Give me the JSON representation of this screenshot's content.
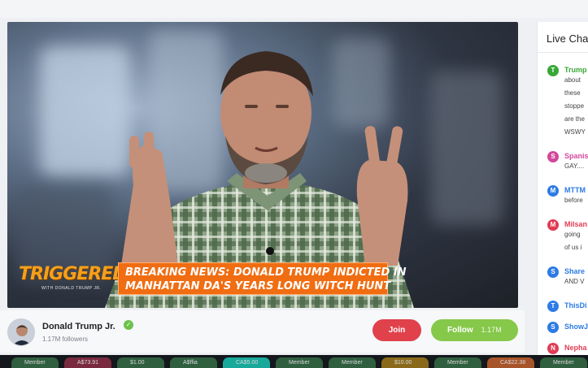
{
  "video": {
    "show_logo": "TRIGGERED",
    "show_logo_sub": "WITH DONALD TRUMP JR.",
    "banner_text": "BREAKING NEWS: DONALD TRUMP INDICTED IN\nMANHATTAN DA'S YEARS LONG WITCH HUNT"
  },
  "channel": {
    "name": "Donald Trump Jr.",
    "followers": "1.17M followers",
    "join_label": "Join",
    "follow_label": "Follow",
    "follow_count": "1.17M"
  },
  "chat": {
    "title": "Live Chat",
    "messages": [
      {
        "user": "Trump",
        "color": "#37a836",
        "lines": [
          "about",
          "these",
          "stoppe",
          "are the",
          "WSWY"
        ]
      },
      {
        "user": "Spanis",
        "color": "#d2489a",
        "lines": [
          "GAY...."
        ]
      },
      {
        "user": "MTTM",
        "color": "#2d7be5",
        "lines": [
          "before"
        ]
      },
      {
        "user": "Milsan",
        "color": "#e03c55",
        "lines": [
          "going",
          "of us i"
        ]
      },
      {
        "user": "Share",
        "color": "#2d7be5",
        "lines": [
          "AND V"
        ]
      },
      {
        "user": "ThisDi",
        "color": "#2d7be5",
        "lines": []
      },
      {
        "user": "ShowJ",
        "color": "#2d7be5",
        "lines": []
      },
      {
        "user": "Nepha",
        "color": "#e03c55",
        "lines": []
      }
    ]
  },
  "dock": {
    "chips": [
      {
        "label": "Member",
        "color": "#2f5f3f"
      },
      {
        "label": "A$73.91",
        "color": "#7a2a3f"
      },
      {
        "label": "$1.00",
        "color": "#2f5f3f"
      },
      {
        "label": "A$ffia",
        "color": "#2f5f3f"
      },
      {
        "label": "CA$5.00",
        "color": "#18a99a"
      },
      {
        "label": "Member",
        "color": "#2f5f3f"
      },
      {
        "label": "Member",
        "color": "#2f5f3f"
      },
      {
        "label": "$10.00",
        "color": "#8a6a1a"
      },
      {
        "label": "Member",
        "color": "#2f5f3f"
      },
      {
        "label": "CA$22.38",
        "color": "#a8542a"
      },
      {
        "label": "Member",
        "color": "#2f5f3f"
      }
    ]
  }
}
